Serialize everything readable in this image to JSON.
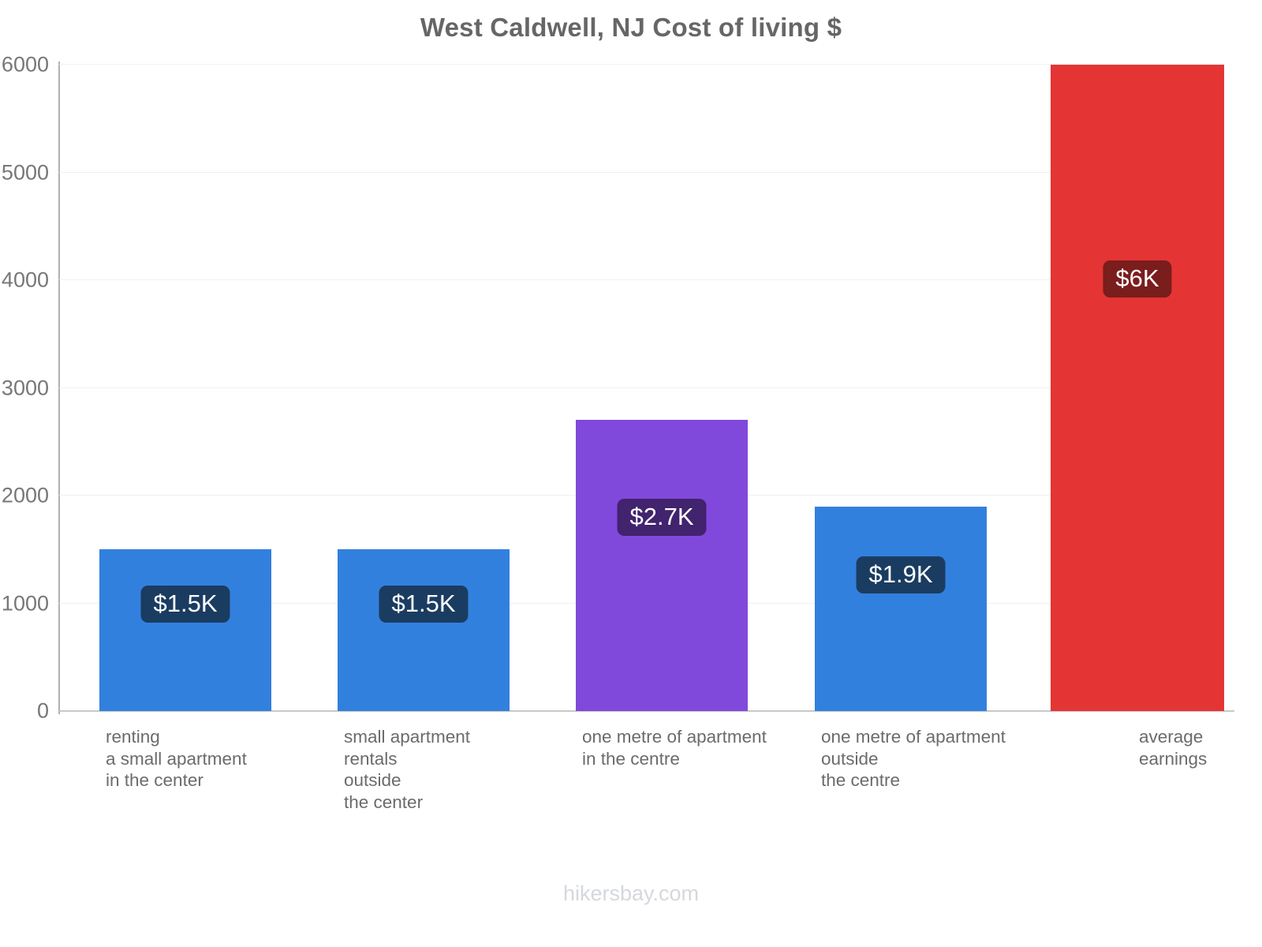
{
  "chart_data": {
    "type": "bar",
    "title": "West Caldwell, NJ Cost of living $",
    "xlabel": "",
    "ylabel": "",
    "ylim": [
      0,
      6000
    ],
    "yticks": [
      0,
      1000,
      2000,
      3000,
      4000,
      5000,
      6000
    ],
    "ytick_labels": [
      "0",
      "1000",
      "2000",
      "3000",
      "4000",
      "5000",
      "6000"
    ],
    "grid": true,
    "legend": "none",
    "categories": [
      "renting\na small apartment\nin the center",
      "small apartment\nrentals\noutside\nthe center",
      "one metre of apartment\nin the centre",
      "one metre of apartment\noutside\nthe centre",
      "average\nearnings"
    ],
    "values": [
      1500,
      1500,
      2700,
      1900,
      6000
    ],
    "data_labels": [
      "$1.5K",
      "$1.5K",
      "$2.7K",
      "$1.9K",
      "$6K"
    ],
    "bar_colors": [
      "#3280de",
      "#3280de",
      "#8148dc",
      "#3280de",
      "#e53434"
    ],
    "label_badge_colors": [
      "#1b3c61",
      "#1b3c61",
      "#41236e",
      "#1b3c61",
      "#7a1d1d"
    ]
  },
  "watermark": "hikersbay.com",
  "colors": {
    "title_text": "#666666",
    "tick_text": "#777777",
    "category_text": "#6b6b6b",
    "axis": "#b0b0b0",
    "gridline": "#f0f0f0",
    "background": "#ffffff",
    "watermark_text": "#d4d8dd"
  }
}
